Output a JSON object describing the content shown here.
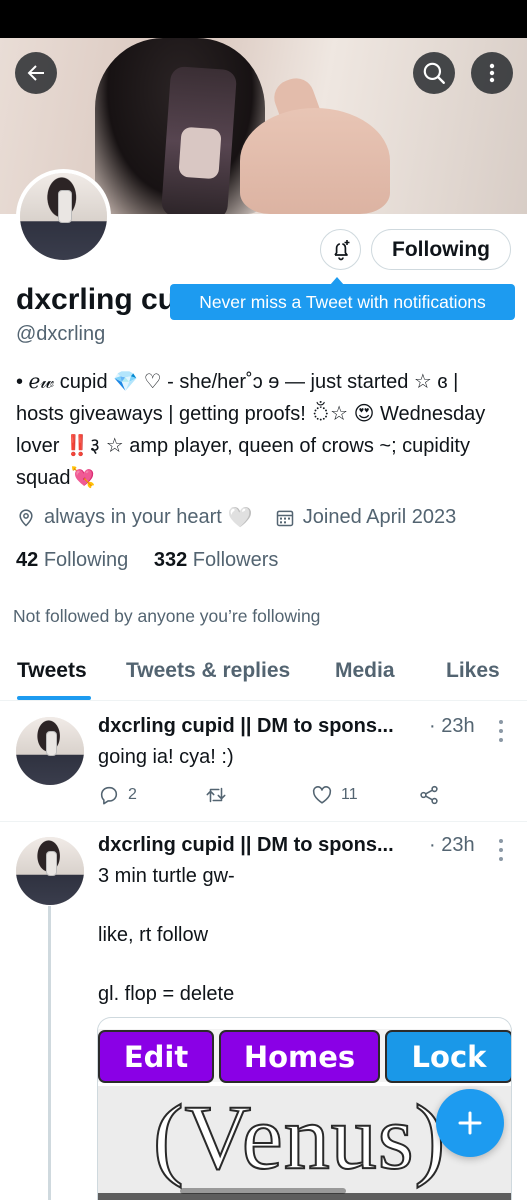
{
  "profile": {
    "display_name": "dxcrling cu",
    "handle": "@dxcrling",
    "following_button": "Following",
    "tooltip": "Never miss a Tweet with notifications",
    "bio": "• ℯ𝓌 cupid 💎 ♡ - she/her˚ↄ ɘ  — just started ☆ ɞ | hosts giveaways | getting proofs! ঁ☆ 😍 Wednesday lover ‼️३  ☆ amp player, queen of crows ~; cupidity squad💘",
    "location": "always in your heart",
    "location_emoji": "🤍",
    "joined": "Joined April 2023",
    "following_count": "42",
    "following_label": "Following",
    "followers_count": "332",
    "followers_label": "Followers",
    "not_followed": "Not followed by anyone you’re following"
  },
  "tabs": [
    {
      "label": "Tweets",
      "active": true
    },
    {
      "label": "Tweets & replies",
      "active": false
    },
    {
      "label": "Media",
      "active": false
    },
    {
      "label": "Likes",
      "active": false
    }
  ],
  "tweets": [
    {
      "name": "dxcrling cupid || DM to spons...",
      "time": "· 23h",
      "text": "going ia! cya! :)",
      "replies": "2",
      "retweets": "",
      "likes": "11"
    },
    {
      "name": "dxcrling cupid || DM to spons...",
      "time": "· 23h",
      "lines": [
        "3 min turtle gw-",
        "like, rt follow",
        "gl. flop = delete"
      ],
      "media_buttons": [
        "Edit",
        "Homes",
        "Lock"
      ],
      "media_text": "(Venus)"
    }
  ],
  "icons": {
    "back": "arrow-left-icon",
    "search": "search-icon",
    "more": "more-vertical-icon",
    "bell": "bell-plus-icon",
    "location": "location-pin-icon",
    "calendar": "calendar-icon",
    "reply": "reply-icon",
    "retweet": "retweet-icon",
    "like": "heart-icon",
    "share": "share-icon",
    "compose": "plus-icon"
  },
  "colors": {
    "accent": "#1d9bf0",
    "text": "#0f1419",
    "secondary": "#536471",
    "edit_btn": "#8a00e6",
    "homes_btn": "#8a00e6",
    "lock_btn": "#1a98e8"
  }
}
